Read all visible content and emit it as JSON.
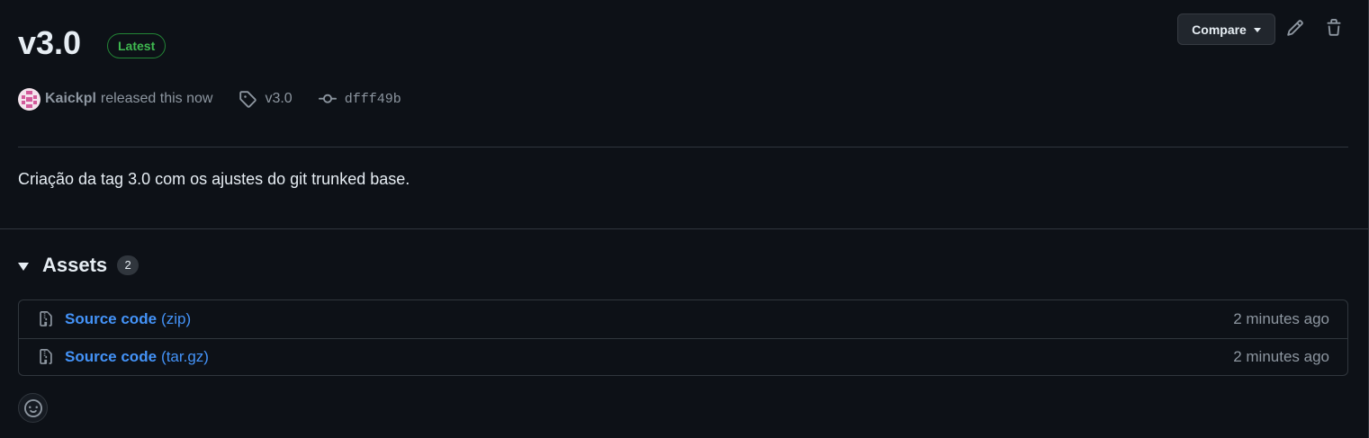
{
  "release": {
    "title": "v3.0",
    "badge": "Latest",
    "author": "Kaickpl",
    "released_text": "released this now",
    "tag": "v3.0",
    "commit": "dfff49b",
    "description": "Criação da tag 3.0 com os ajustes do git trunked base."
  },
  "toolbar": {
    "compare_label": "Compare",
    "edit_icon": "pencil-icon",
    "delete_icon": "trash-icon"
  },
  "assets": {
    "title": "Assets",
    "count": "2",
    "items": [
      {
        "name": "Source code",
        "type": "(zip)",
        "time": "2 minutes ago"
      },
      {
        "name": "Source code",
        "type": "(tar.gz)",
        "time": "2 minutes ago"
      }
    ]
  },
  "colors": {
    "background": "#0d1117",
    "link": "#4493f8",
    "badge_green": "#3fb950",
    "muted": "#8d96a0"
  }
}
